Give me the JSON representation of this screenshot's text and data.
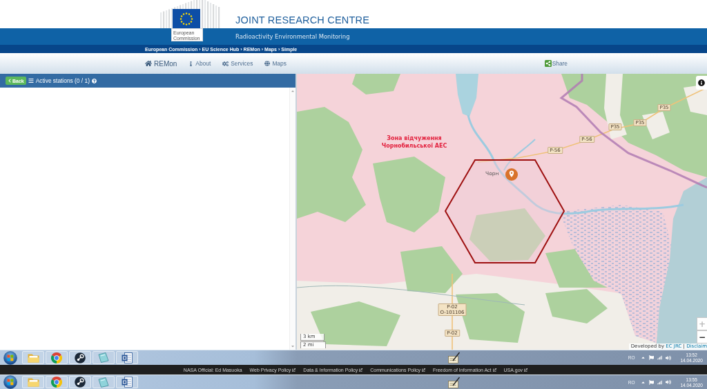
{
  "header": {
    "logo_label": "European Commission",
    "title": "JOINT RESEARCH CENTRE",
    "subtitle": "Radioactivity Environmental Monitoring"
  },
  "breadcrumb": {
    "separator": "›",
    "items": [
      "European Commission",
      "EU Science Hub",
      "REMon",
      "Maps",
      "Simple"
    ]
  },
  "nav": {
    "items": [
      {
        "kind": "home",
        "label": "REMon"
      },
      {
        "kind": "info",
        "label": "About"
      },
      {
        "kind": "services",
        "label": "Services"
      },
      {
        "kind": "maps",
        "label": "Maps"
      }
    ],
    "share": "Share"
  },
  "stations_panel": {
    "back_button": "Back",
    "title": "Active stations (0 / 1)"
  },
  "map": {
    "zone_label": "Зона відчуження Чорнобильської АЕС",
    "town_label": "Чорн",
    "road_labels": [
      "P-56",
      "P-56",
      "P35",
      "P35",
      "P35",
      "P-02 O-101106",
      "P-02"
    ],
    "zoom_controls": [
      {
        "label": "+",
        "disabled": true
      },
      {
        "label": "−",
        "disabled": false
      }
    ],
    "scale": [
      "3 km",
      "2 mi"
    ],
    "attribution": {
      "text": "Developed by",
      "link": "EC JRC",
      "separator": "|",
      "cut_link": "Disclaim"
    }
  },
  "taskbars": [
    {
      "language": "RO",
      "time": "13:52",
      "date": "14.04.2020"
    },
    {
      "language": "RO",
      "time": "13:55",
      "date": "14.04.2020"
    }
  ],
  "footer": {
    "official": "NASA Official: Ed Masuoka",
    "links": [
      "Web Privacy Policy",
      "Data & Information Policy",
      "Communications Policy",
      "Freedom of Information Act",
      "USA.gov"
    ]
  }
}
